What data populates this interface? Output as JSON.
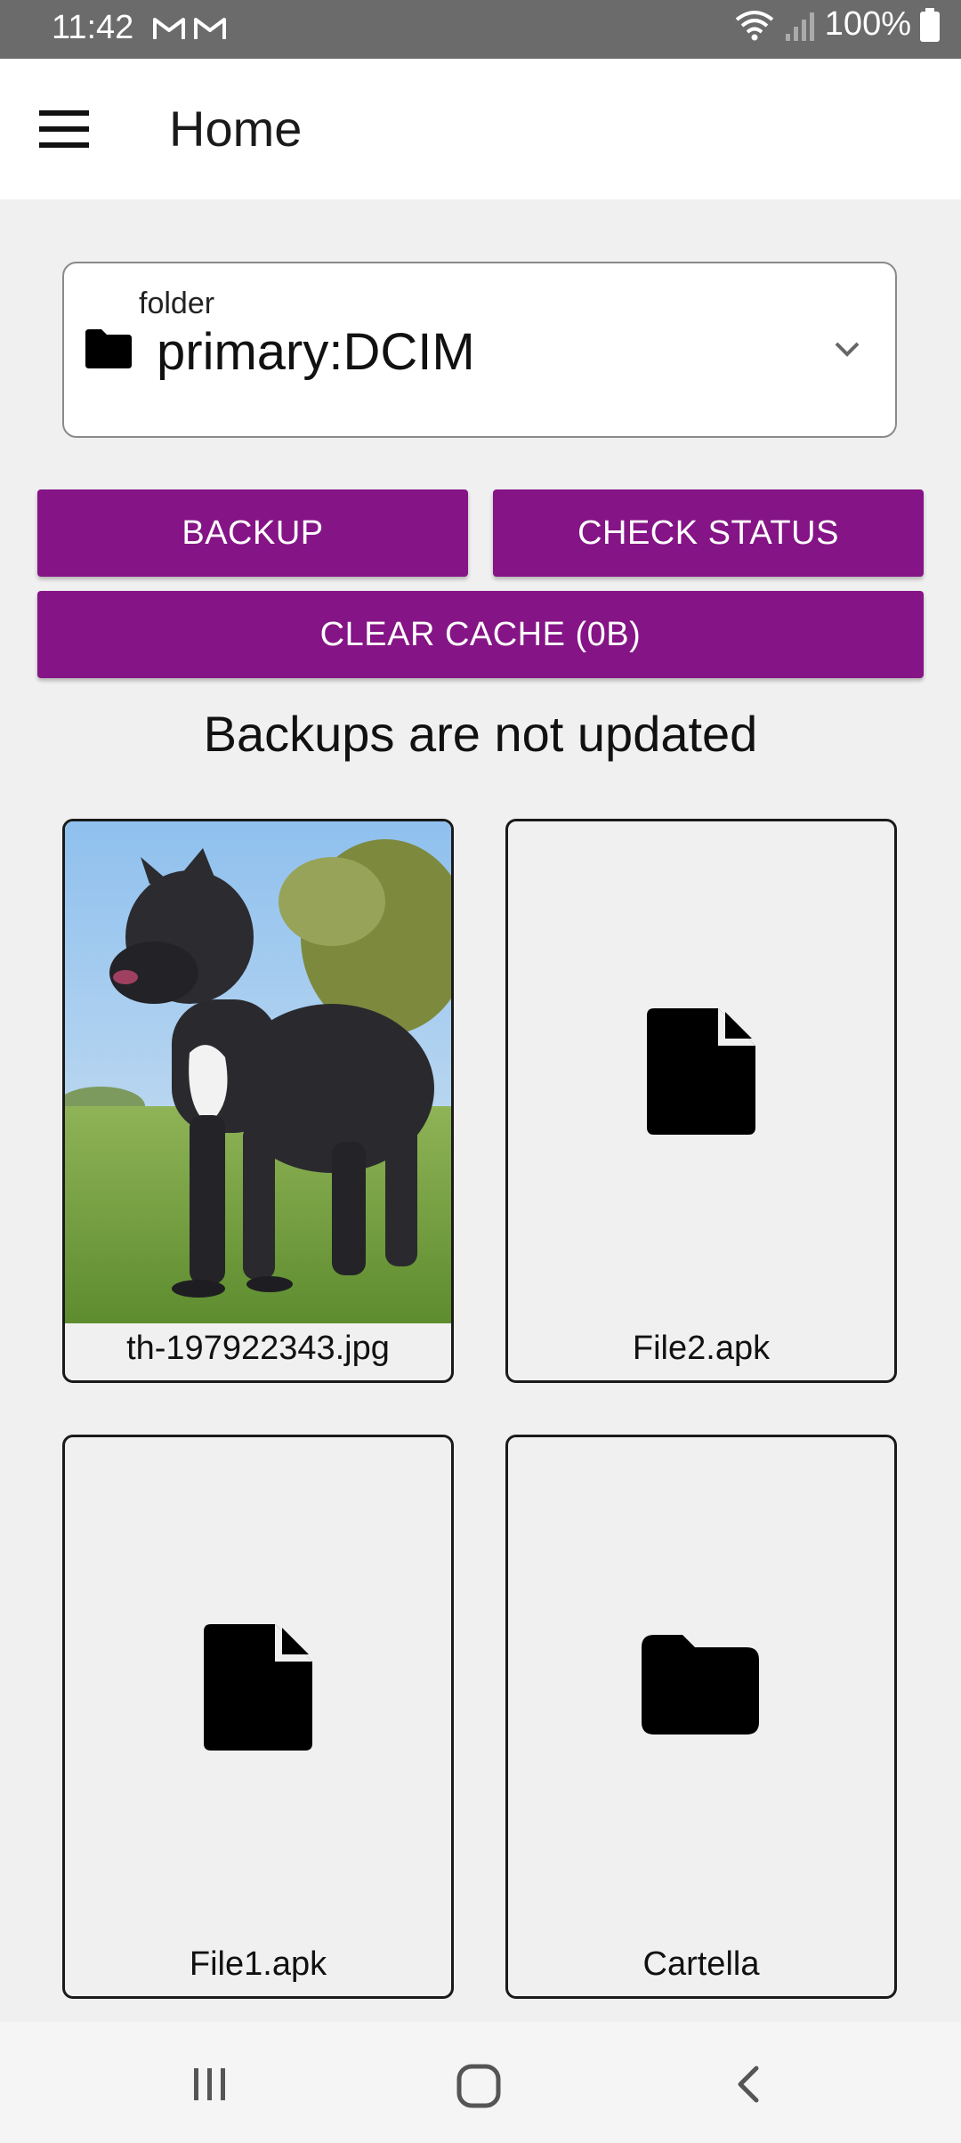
{
  "status_bar": {
    "time": "11:42",
    "battery": "100%",
    "icons": [
      "gmail-icon",
      "gmail-icon",
      "wifi-icon",
      "signal-icon",
      "battery-icon"
    ]
  },
  "app_bar": {
    "title": "Home",
    "menu_icon": "menu-icon"
  },
  "folder_select": {
    "label": "folder",
    "value": "primary:DCIM",
    "icon": "folder-icon",
    "dropdown_icon": "chevron-down-icon"
  },
  "buttons": {
    "backup": "BACKUP",
    "check_status": "CHECK STATUS",
    "clear_cache": "CLEAR CACHE (0B)",
    "color": "#851486"
  },
  "status_message": "Backups are not updated",
  "files": [
    {
      "name": "th-197922343.jpg",
      "type": "image"
    },
    {
      "name": "File2.apk",
      "type": "file"
    },
    {
      "name": "File1.apk",
      "type": "file"
    },
    {
      "name": "Cartella",
      "type": "folder"
    }
  ],
  "nav_bar": {
    "icons": [
      "recents-icon",
      "home-icon",
      "back-icon"
    ]
  }
}
